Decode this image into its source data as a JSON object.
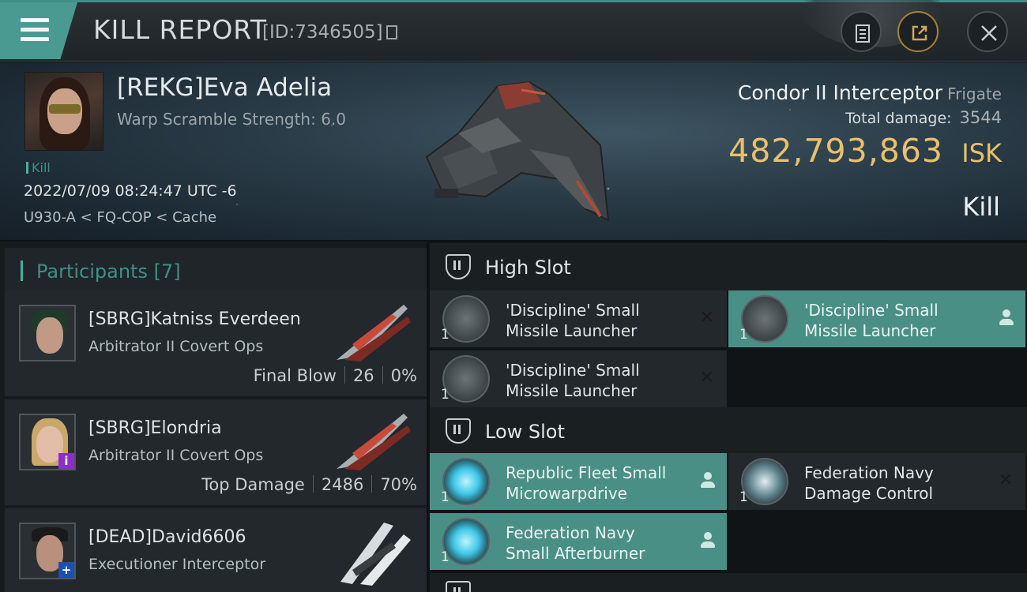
{
  "header": {
    "title": "KILL REPORT",
    "kill_id": "[ID:7346505]"
  },
  "victim": {
    "name": "[REKG]Eva Adelia",
    "subtitle": "Warp Scramble Strength: 6.0",
    "tag": "Kill",
    "timestamp": "2022/07/09 08:24:47 UTC -6",
    "location": "U930-A < FQ-COP < Cache",
    "ship_name": "Condor II Interceptor",
    "ship_class": "Frigate",
    "total_damage_label": "Total damage:",
    "total_damage": "3544",
    "isk_value": "482,793,863",
    "isk_unit": "ISK",
    "result": "Kill"
  },
  "participants": {
    "title": "Participants [7]",
    "rows": [
      {
        "name": "[SBRG]Katniss Everdeen",
        "ship": "Arbitrator II Covert Ops",
        "role": "Final Blow",
        "damage": "26",
        "percent": "0%"
      },
      {
        "name": "[SBRG]Elondria",
        "ship": "Arbitrator II Covert Ops",
        "role": "Top Damage",
        "damage": "2486",
        "percent": "70%"
      },
      {
        "name": "[DEAD]David6606",
        "ship": "Executioner Interceptor",
        "role": "",
        "damage": "",
        "percent": ""
      }
    ]
  },
  "fitting": {
    "high_slot": {
      "title": "High Slot",
      "modules": [
        {
          "line1": "'Discipline' Small",
          "line2": "Missile Launcher",
          "qty": "1",
          "status": "destroyed"
        },
        {
          "line1": "'Discipline' Small",
          "line2": "Missile Launcher",
          "qty": "1",
          "status": "dropped"
        },
        {
          "line1": "'Discipline' Small",
          "line2": "Missile Launcher",
          "qty": "1",
          "status": "destroyed"
        }
      ]
    },
    "low_slot": {
      "title": "Low Slot",
      "modules": [
        {
          "line1": "Republic Fleet Small",
          "line2": "Microwarpdrive",
          "qty": "1",
          "status": "dropped"
        },
        {
          "line1": "Federation Navy",
          "line2": "Damage Control",
          "qty": "1",
          "status": "destroyed"
        },
        {
          "line1": "Federation Navy",
          "line2": "Small Afterburner",
          "qty": "1",
          "status": "dropped"
        }
      ]
    }
  },
  "colors": {
    "accent": "#4a9a91",
    "isk": "#e9c06b",
    "dropped": "#4a8f86"
  }
}
